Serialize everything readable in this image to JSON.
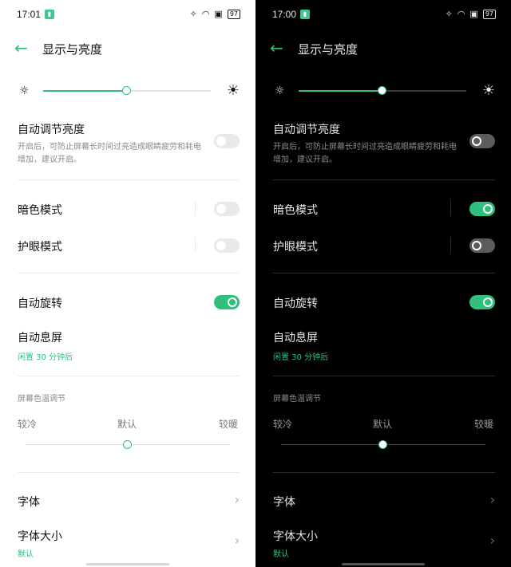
{
  "screens": [
    {
      "theme": "light",
      "status": {
        "time": "17:01",
        "notif_icon": "app-notification-icon",
        "battery": "97"
      },
      "header": {
        "back_icon": "back-arrow-icon",
        "title": "显示与亮度"
      },
      "brightness": {
        "level": 0.5
      },
      "auto_brightness": {
        "label": "自动调节亮度",
        "desc": "开启后，可防止屏幕长时间过亮造成眼睛疲劳和耗电增加，建议开启。",
        "on": false
      },
      "dark_mode": {
        "label": "暗色模式",
        "on": false
      },
      "eye_mode": {
        "label": "护眼模式",
        "on": false
      },
      "auto_rotate": {
        "label": "自动旋转",
        "on": true
      },
      "screen_off": {
        "label": "自动息屏",
        "value": "闲置 30 分钟后"
      },
      "color_temp": {
        "title": "屏幕色温调节",
        "cold": "较冷",
        "default": "默认",
        "warm": "较暖",
        "level": 0.5
      },
      "font": {
        "label": "字体"
      },
      "font_size": {
        "label": "字体大小",
        "value": "默认"
      }
    },
    {
      "theme": "dark",
      "status": {
        "time": "17:00",
        "notif_icon": "app-notification-icon",
        "battery": "97"
      },
      "header": {
        "back_icon": "back-arrow-icon",
        "title": "显示与亮度"
      },
      "brightness": {
        "level": 0.5
      },
      "auto_brightness": {
        "label": "自动调节亮度",
        "desc": "开启后，可防止屏幕长时间过亮造成眼睛疲劳和耗电增加，建议开启。",
        "on": false
      },
      "dark_mode": {
        "label": "暗色模式",
        "on": true
      },
      "eye_mode": {
        "label": "护眼模式",
        "on": false
      },
      "auto_rotate": {
        "label": "自动旋转",
        "on": true
      },
      "screen_off": {
        "label": "自动息屏",
        "value": "闲置 30 分钟后"
      },
      "color_temp": {
        "title": "屏幕色温调节",
        "cold": "较冷",
        "default": "默认",
        "warm": "较暖",
        "level": 0.5
      },
      "font": {
        "label": "字体"
      },
      "font_size": {
        "label": "字体大小",
        "value": "默认"
      }
    }
  ],
  "colors": {
    "accent": "#2fc07d"
  }
}
